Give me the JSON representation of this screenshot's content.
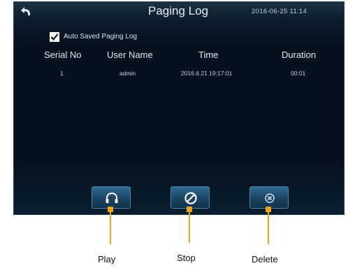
{
  "header": {
    "title": "Paging Log",
    "datetime": "2016-06-25  11:14"
  },
  "options": {
    "auto_saved_label": "Auto Saved Paging Log",
    "auto_saved_checked": true
  },
  "table": {
    "columns": [
      "Serial No",
      "User Name",
      "Time",
      "Duration"
    ],
    "rows": [
      [
        "1",
        "admin",
        "2016.6.21 19:17:01",
        "00:01"
      ]
    ]
  },
  "buttons": {
    "play_icon": "headphones-icon",
    "stop_icon": "stop-circle-icon",
    "delete_icon": "delete-circle-icon"
  },
  "callouts": {
    "play": "Play",
    "stop": "Stop",
    "delete": "Delete"
  },
  "colors": {
    "screen_bg": "#07111d",
    "button_bg": "#1b4463",
    "callout": "#f0a21c"
  }
}
